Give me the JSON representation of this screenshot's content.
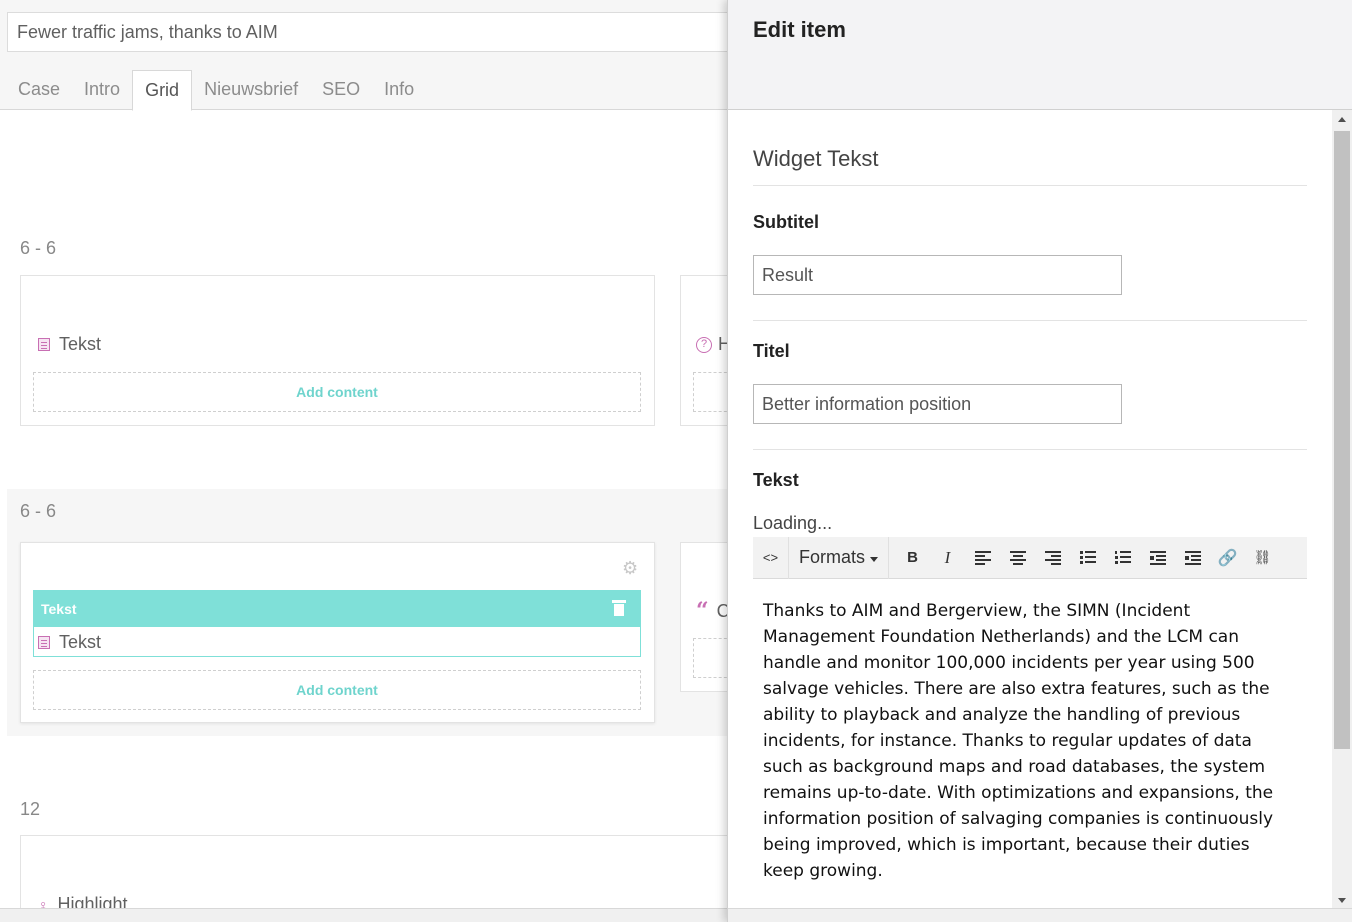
{
  "document": {
    "name": "Fewer traffic jams, thanks to AIM",
    "tabs": [
      "Case",
      "Intro",
      "Grid",
      "Nieuwsbrief",
      "SEO",
      "Info"
    ],
    "active_tab": "Grid"
  },
  "grid": {
    "rows": [
      {
        "layout": "6 - 6",
        "left_cell": {
          "control_label": "Tekst",
          "add_content": "Add content"
        },
        "right_cell": {
          "control_label": "H"
        }
      },
      {
        "layout": "6 - 6",
        "left_cell": {
          "selected_control_header": "Tekst",
          "control_label": "Tekst",
          "add_content": "Add content"
        },
        "right_cell": {
          "control_label": "C"
        }
      },
      {
        "layout": "12",
        "left_cell": {
          "control_label": "Highlight"
        }
      }
    ]
  },
  "edit_panel": {
    "title": "Edit item",
    "widget_title": "Widget Tekst",
    "fields": {
      "subtitel": {
        "label": "Subtitel",
        "value": "Result"
      },
      "titel": {
        "label": "Titel",
        "value": "Better information position"
      },
      "tekst": {
        "label": "Tekst",
        "status": "Loading...",
        "toolbar": {
          "formats_label": "Formats",
          "buttons": [
            "source-code",
            "bold",
            "italic",
            "align-left",
            "align-center",
            "align-right",
            "bullet-list",
            "numbered-list",
            "outdent",
            "indent",
            "link",
            "unlink"
          ]
        },
        "content_lines": [
          "Thanks to AIM and Bergerview, the SIMN (Incident",
          "Management Foundation Netherlands) and the LCM can",
          "handle and monitor 100,000 incidents per year using 500",
          "salvage vehicles. There are also extra features, such as the",
          "ability to playback and analyze the handling of previous",
          "incidents, for instance. Thanks to regular updates of data",
          "such as background maps and road databases, the system",
          "remains up-to-date. With optimizations and expansions, the",
          "information position of salvaging companies is continuously",
          "being improved, which is important, because their duties",
          "keep growing."
        ]
      }
    }
  },
  "colors": {
    "accent_teal": "#7fe0d8",
    "icon_pink": "#c86fb3",
    "add_content_text": "#6fd4cd"
  }
}
